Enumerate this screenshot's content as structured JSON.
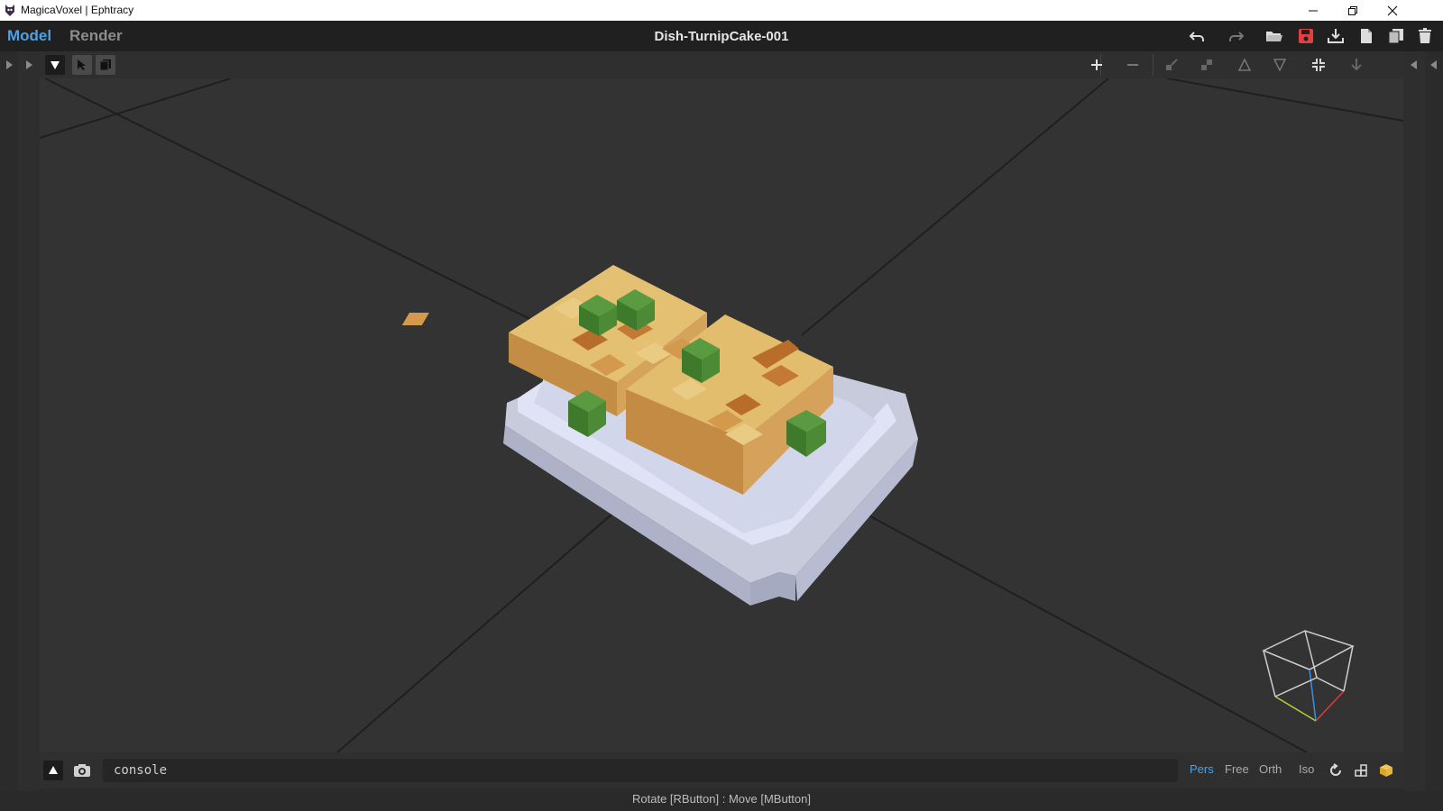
{
  "window": {
    "title": "MagicaVoxel | Ephtracy"
  },
  "menubar": {
    "tabs": [
      {
        "label": "Model",
        "active": true
      },
      {
        "label": "Render",
        "active": false
      }
    ],
    "document_title": "Dish-TurnipCake-001",
    "icons": [
      "undo-icon",
      "redo-icon",
      "open-folder-icon",
      "save-icon",
      "export-icon",
      "new-file-icon",
      "copy-file-icon",
      "delete-icon"
    ]
  },
  "viewport_toolbar": {
    "left_icons": [
      "dropdown-triangle-icon",
      "select-cursor-icon",
      "clone-icon"
    ],
    "right_icons": [
      "zoom-in-icon",
      "zoom-out-icon",
      "shrink-icon",
      "expand-icon",
      "flip-up-icon",
      "flip-down-icon",
      "fit-icon",
      "drop-icon"
    ]
  },
  "bottombar": {
    "console_text": "console",
    "view_modes": [
      {
        "label": "Pers",
        "active": true
      },
      {
        "label": "Free",
        "active": false
      },
      {
        "label": "Orth",
        "active": false
      },
      {
        "label": "Iso",
        "active": false
      }
    ]
  },
  "status_text": "Rotate [RButton] : Move [MButton]",
  "colors": {
    "accent": "#4aa3e8",
    "save_red": "#e04040",
    "background": "#333333",
    "plate": "#dfe3f5",
    "cake_light": "#e6c375",
    "cake_mid": "#d39a4e",
    "cake_dark": "#b96d2a",
    "scallion": "#4b8a36"
  }
}
